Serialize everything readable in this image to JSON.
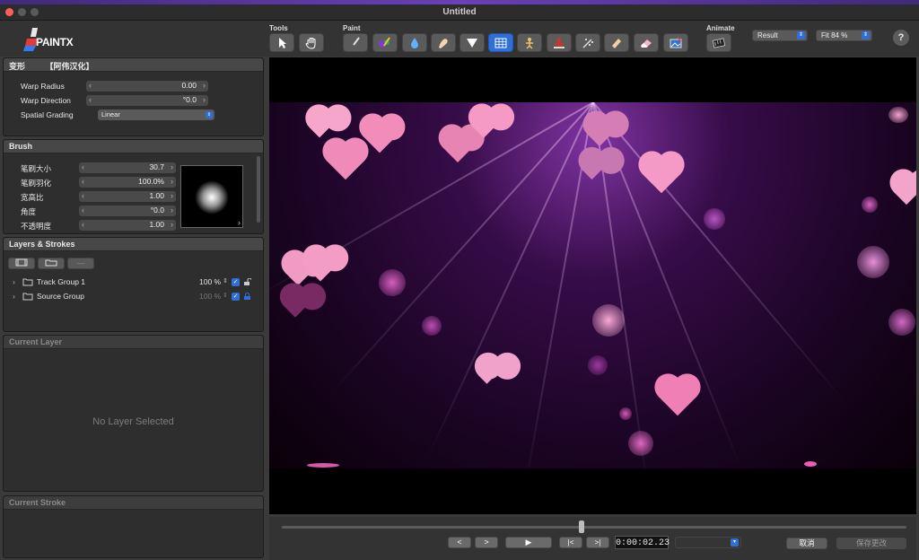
{
  "window": {
    "title": "Untitled"
  },
  "toolbar": {
    "logo_text": "PAINTX",
    "tools_label": "Tools",
    "paint_label": "Paint",
    "animate_label": "Animate",
    "tools": [
      "select-arrow-icon",
      "hand-icon"
    ],
    "paint_tools": [
      "brush-icon",
      "color-brush-icon",
      "drop-icon",
      "smudge-icon",
      "funnel-icon",
      "grid-warp-icon",
      "puppet-icon",
      "stamp-icon",
      "scatter-icon",
      "eraser-block-icon",
      "eraser-icon",
      "transform-image-icon"
    ],
    "active_paint_tool": "grid-warp-icon",
    "view_mode": "Result",
    "zoom": "Fit 84 %",
    "help_label": "?",
    "accent": "#2f6fd6"
  },
  "deform_panel": {
    "title": "变形",
    "subtitle": "【阿伟汉化】",
    "warp_radius_label": "Warp Radius",
    "warp_radius_value": "0.00",
    "warp_direction_label": "Warp Direction",
    "warp_direction_value": "°0.0",
    "spatial_grading_label": "Spatial Grading",
    "spatial_grading_value": "Linear"
  },
  "brush_panel": {
    "title": "Brush",
    "size_label": "笔刷大小",
    "size_value": "30.7",
    "feather_label": "笔刷羽化",
    "feather_value": "100.0%",
    "aspect_label": "宽高比",
    "aspect_value": "1.00",
    "angle_label": "角度",
    "angle_value": "°0.0",
    "opacity_label": "不透明度",
    "opacity_value": "1.00"
  },
  "layers_panel": {
    "title": "Layers & Strokes",
    "remove_label": "—",
    "rows": [
      {
        "name": "Track Group 1",
        "opacity": "100 %",
        "checked": true,
        "locked": false
      },
      {
        "name": "Source Group",
        "opacity": "100 %",
        "checked": true,
        "locked": true
      }
    ]
  },
  "current_layer_panel": {
    "title": "Current Layer",
    "empty_text": "No Layer Selected"
  },
  "current_stroke_panel": {
    "title": "Current Stroke"
  },
  "playback": {
    "prev_label": "<",
    "next_label": ">",
    "play_label": "▶",
    "to_start_label": "|<",
    "to_end_label": ">|",
    "timecode": "0:00:02.23",
    "cancel_label": "取消",
    "save_label": "保存更改",
    "playhead_position": 0.48
  }
}
